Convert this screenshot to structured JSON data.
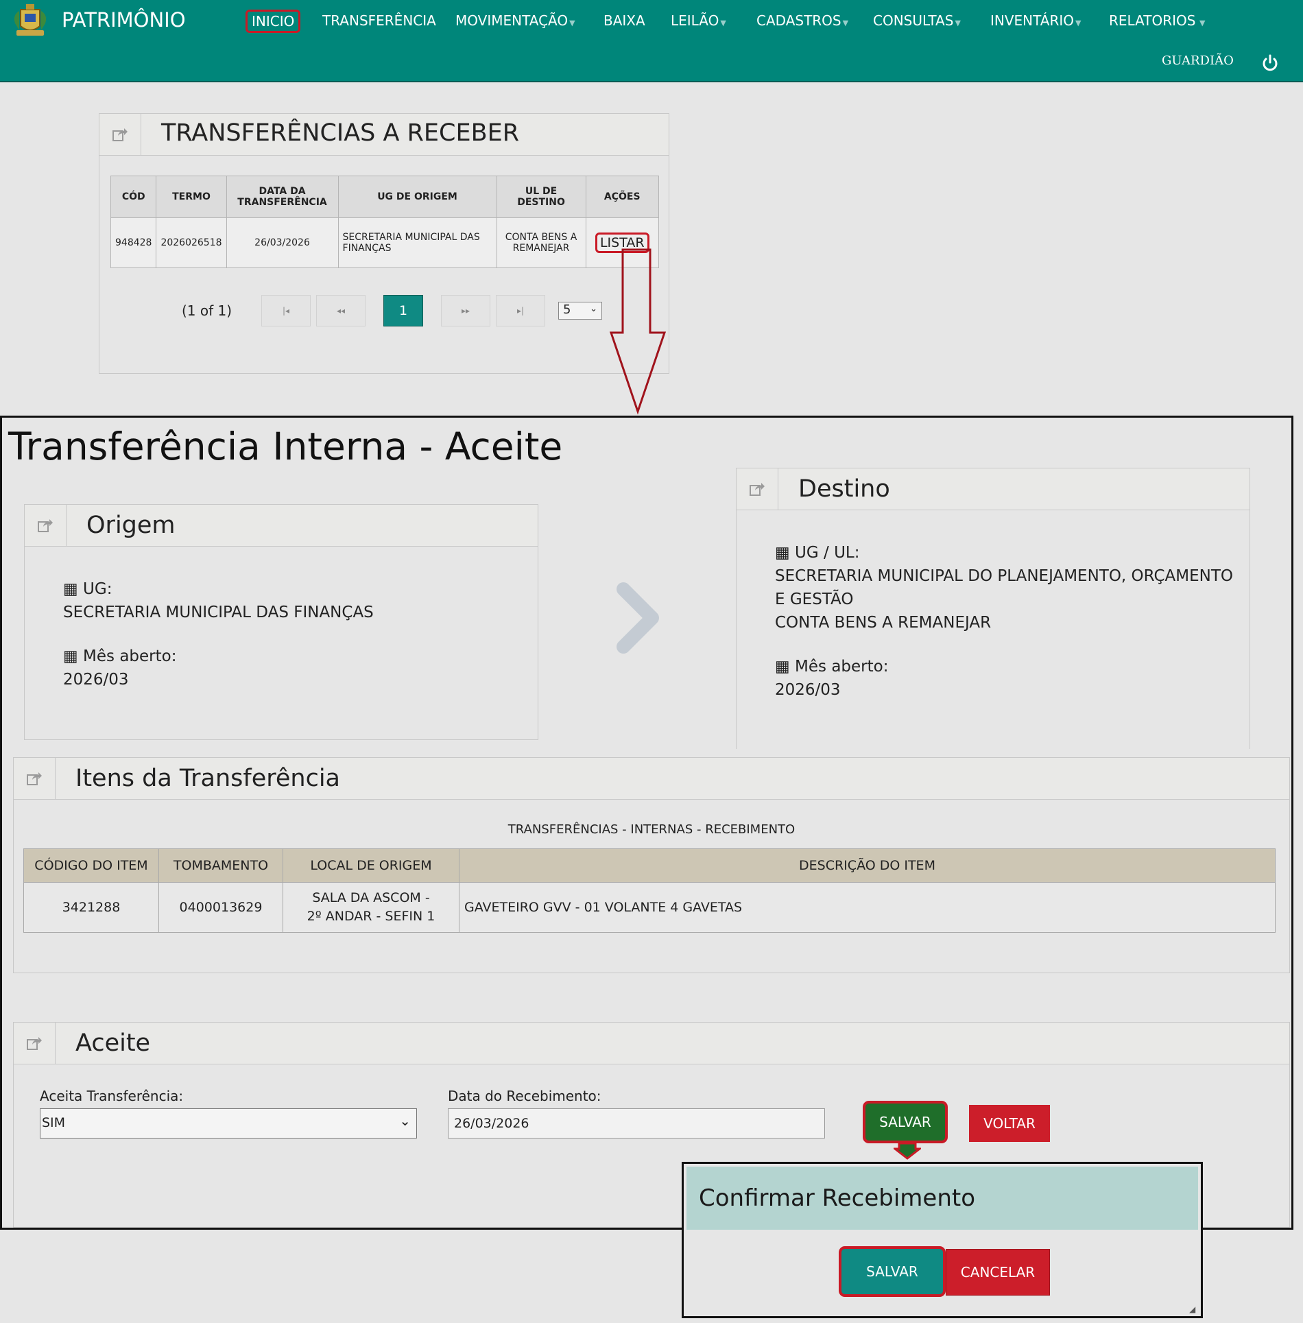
{
  "navbar": {
    "app_name": "PATRIMÔNIO",
    "items": [
      "INICIO",
      "TRANSFERÊNCIA",
      "MOVIMENTAÇÃO",
      "BAIXA",
      "LEILÃO",
      "CADASTROS",
      "CONSULTAS",
      "INVENTÁRIO",
      "RELATORIOS"
    ],
    "user": "GUARDIÃO",
    "brand_color": "#00867a"
  },
  "receive_panel": {
    "title": "TRANSFERÊNCIAS A RECEBER",
    "columns": [
      "CÓD",
      "TERMO",
      "DATA DA TRANSFERÊNCIA",
      "UG DE ORIGEM",
      "UL DE DESTINO",
      "AÇÕES"
    ],
    "row": {
      "cod": "948428",
      "termo": "2026026518",
      "data": "26/03/2026",
      "ug_origem": "SECRETARIA MUNICIPAL DAS FINANÇAS",
      "ul_destino": "CONTA BENS A REMANEJAR",
      "acao": "LISTAR"
    },
    "pagination": {
      "summary": "(1 of 1)",
      "current_page": "1",
      "page_size": "5"
    }
  },
  "detail": {
    "title": "Transferência Interna - Aceite",
    "origem": {
      "title": "Origem",
      "ug_label": "UG:",
      "ug_value": "SECRETARIA MUNICIPAL DAS FINANÇAS",
      "mes_label": "Mês aberto:",
      "mes_value": "2026/03"
    },
    "destino": {
      "title": "Destino",
      "ug_ul_label": "UG / UL:",
      "ug_value_line1": "SECRETARIA MUNICIPAL DO PLANEJAMENTO, ORÇAMENTO",
      "ug_value_line2": "E GESTÃO",
      "ul_value": "CONTA BENS A REMANEJAR",
      "mes_label": "Mês aberto:",
      "mes_value": "2026/03"
    },
    "itens": {
      "title": "Itens da Transferência",
      "table_caption": "TRANSFERÊNCIAS - INTERNAS - RECEBIMENTO",
      "columns": [
        "CÓDIGO DO ITEM",
        "TOMBAMENTO",
        "LOCAL DE ORIGEM",
        "DESCRIÇÃO DO ITEM"
      ],
      "row": {
        "codigo": "3421288",
        "tombamento": "0400013629",
        "local": "SALA DA ASCOM - 2º ANDAR - SEFIN 1",
        "descricao": "GAVETEIRO GVV - 01 VOLANTE 4 GAVETAS"
      }
    },
    "aceite": {
      "title": "Aceite",
      "aceita_label": "Aceita Transferência:",
      "aceita_value": "SIM",
      "data_label": "Data do Recebimento:",
      "data_value": "26/03/2026",
      "salvar": "SALVAR",
      "voltar": "VOLTAR"
    }
  },
  "dialog": {
    "title": "Confirmar Recebimento",
    "salvar": "SALVAR",
    "cancelar": "CANCELAR"
  },
  "colors": {
    "highlight": "#c91a26",
    "save_green": "#1f6e2a",
    "voltar_red": "#cc1e2a",
    "teal_btn": "#0f8a83",
    "dialog_header": "#b4d4d0"
  }
}
